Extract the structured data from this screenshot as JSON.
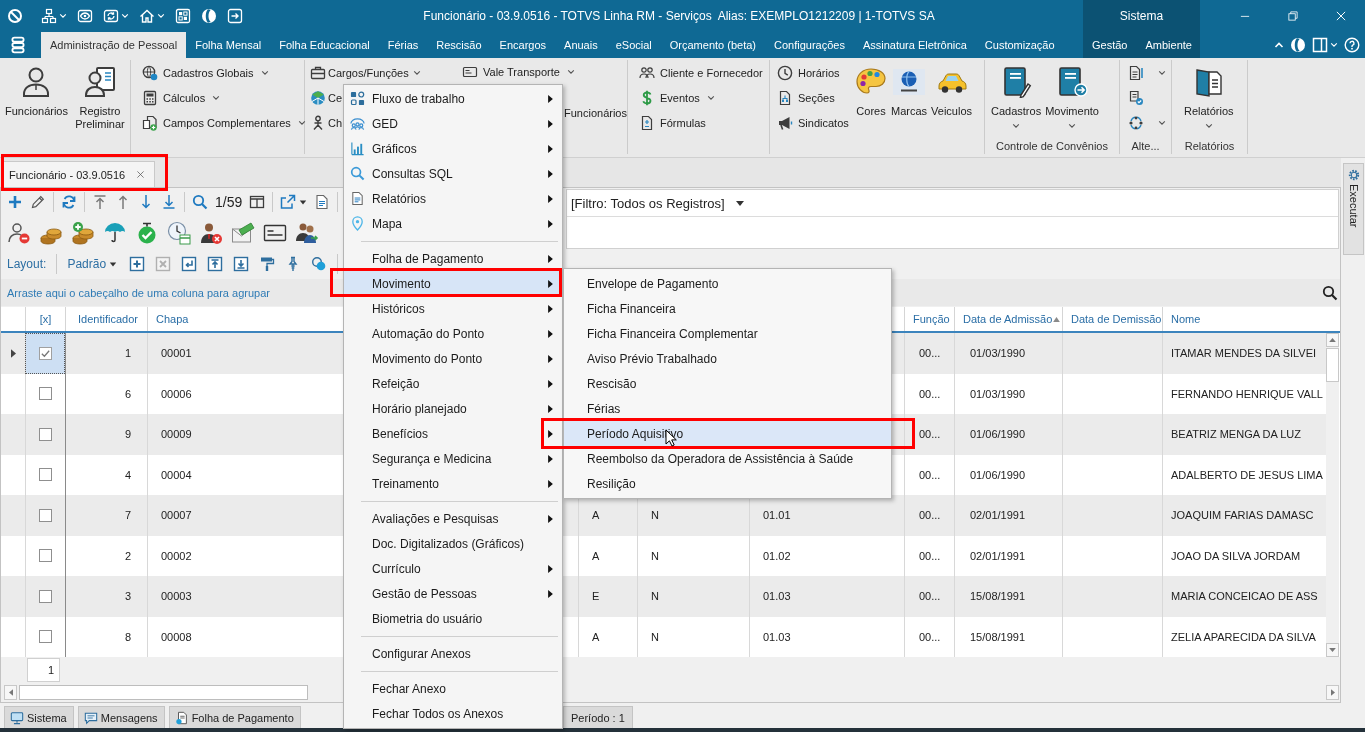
{
  "title_bar": {
    "title": "Funcionário - 03.9.0516 - TOTVS Linha RM - Serviços  Alias: EXEMPLO1212209 | 1-TOTVS SA",
    "context_title": "Sistema"
  },
  "ribbon": {
    "tabs": [
      {
        "label": "Administração de Pessoal",
        "selected": true,
        "kind": "main"
      },
      {
        "label": "Folha Mensal",
        "selected": false,
        "kind": "main"
      },
      {
        "label": "Folha Educacional",
        "selected": false,
        "kind": "main"
      },
      {
        "label": "Férias",
        "selected": false,
        "kind": "main"
      },
      {
        "label": "Rescisão",
        "selected": false,
        "kind": "main"
      },
      {
        "label": "Encargos",
        "selected": false,
        "kind": "main"
      },
      {
        "label": "Anuais",
        "selected": false,
        "kind": "main"
      },
      {
        "label": "eSocial",
        "selected": false,
        "kind": "main"
      },
      {
        "label": "Orçamento (beta)",
        "selected": false,
        "kind": "main"
      },
      {
        "label": "Configurações",
        "selected": false,
        "kind": "main"
      },
      {
        "label": "Assinatura Eletrônica",
        "selected": false,
        "kind": "main"
      },
      {
        "label": "Customização",
        "selected": false,
        "kind": "main"
      },
      {
        "label": "Gestão",
        "selected": false,
        "kind": "context"
      },
      {
        "label": "Ambiente",
        "selected": false,
        "kind": "context"
      }
    ],
    "groups": [
      {
        "items": [
          {
            "label": "Funcionários",
            "kind": "large",
            "dropdown": false
          },
          {
            "label": "Registro Preliminar",
            "kind": "large",
            "dropdown": false
          }
        ]
      },
      {
        "items": [
          {
            "label": "Cadastros Globais",
            "kind": "small",
            "dropdown": true
          },
          {
            "label": "Cálculos",
            "kind": "small",
            "dropdown": true
          },
          {
            "label": "Campos Complementares",
            "kind": "small",
            "dropdown": true
          }
        ]
      },
      {
        "items": [
          {
            "label": "Cargos/Funções",
            "kind": "small",
            "dropdown": true
          },
          {
            "label": "Ce",
            "kind": "small"
          },
          {
            "label": "Ch",
            "kind": "small"
          },
          {
            "label": "Vale Transporte",
            "kind": "medium",
            "dropdown": true
          },
          {
            "label": "Funcionários",
            "kind": "medium",
            "dropdown": false
          }
        ]
      },
      {
        "items": [
          {
            "label": "Cliente e Fornecedor",
            "kind": "small",
            "dropdown": false
          },
          {
            "label": "Eventos",
            "kind": "small",
            "dropdown": true
          },
          {
            "label": "Fórmulas",
            "kind": "small",
            "dropdown": false
          }
        ]
      },
      {
        "items": [
          {
            "label": "Horários",
            "kind": "small",
            "dropdown": false
          },
          {
            "label": "Seções",
            "kind": "small",
            "dropdown": false
          },
          {
            "label": "Sindicatos",
            "kind": "small",
            "dropdown": false
          },
          {
            "label": "Cores",
            "kind": "large",
            "dropdown": false
          },
          {
            "label": "Marcas",
            "kind": "large",
            "dropdown": false
          },
          {
            "label": "Veiculos",
            "kind": "large",
            "dropdown": false
          }
        ]
      },
      {
        "title": "Controle de Convênios",
        "items": [
          {
            "label": "Cadastros",
            "kind": "large",
            "dropdown": true
          },
          {
            "label": "Movimento",
            "kind": "large",
            "dropdown": true
          }
        ]
      },
      {
        "title": "Alte...",
        "items": [
          {
            "kind": "icon",
            "dropdown": true
          },
          {
            "kind": "icon",
            "dropdown": false
          },
          {
            "kind": "icon",
            "dropdown": true
          }
        ]
      },
      {
        "title": "Relatórios",
        "items": [
          {
            "label": "Relatórios",
            "kind": "large",
            "dropdown": true
          }
        ]
      }
    ]
  },
  "document_tabs": [
    {
      "label": "Funcionário - 03.9.0516",
      "selected": true,
      "highlighted": true
    }
  ],
  "side_panel": {
    "label": "Executar"
  },
  "toolbar": {
    "record_position": "1/59"
  },
  "filter": {
    "value": "[Filtro: Todos os Registros]"
  },
  "layout_bar": {
    "label": "Layout:",
    "layout": "Padrão"
  },
  "group_panel": {
    "hint": "Arraste aqui o cabeçalho de uma coluna para agrupar"
  },
  "table": {
    "columns": [
      {
        "label": "[x]"
      },
      {
        "label": "Identificador"
      },
      {
        "label": "Chapa"
      },
      {
        "label": "Função"
      },
      {
        "label": "Data de Admissão",
        "sorted": true
      },
      {
        "label": "Data de Demissão"
      },
      {
        "label": "Nome"
      }
    ],
    "rows": [
      {
        "selected": true,
        "checked": true,
        "identificador": "1",
        "chapa": "00001",
        "funcao": "00...",
        "data_de_admissao": "01/03/1990",
        "nome": "ITAMAR MENDES DA SILVEI"
      },
      {
        "selected": false,
        "checked": false,
        "identificador": "6",
        "chapa": "00006",
        "funcao": "00...",
        "data_de_admissao": "01/03/1990",
        "nome": "FERNANDO HENRIQUE VALL"
      },
      {
        "selected": false,
        "checked": false,
        "identificador": "9",
        "chapa": "00009",
        "funcao": "00...",
        "data_de_admissao": "01/06/1990",
        "nome": "BEATRIZ MENGA DA LUZ"
      },
      {
        "selected": false,
        "checked": false,
        "identificador": "4",
        "chapa": "00004",
        "funcao": "00...",
        "data_de_admissao": "01/06/1990",
        "nome": "ADALBERTO DE JESUS LIMA"
      },
      {
        "selected": false,
        "checked": false,
        "identificador": "7",
        "chapa": "00007",
        "column_4": "A",
        "column_5": "N",
        "column_6": "01.01",
        "funcao": "00...",
        "data_de_admissao": "02/01/1991",
        "nome": "JOAQUIM FARIAS DAMASC"
      },
      {
        "selected": false,
        "checked": false,
        "identificador": "2",
        "chapa": "00002",
        "column_4": "A",
        "column_5": "N",
        "column_6": "01.02",
        "funcao": "00...",
        "data_de_admissao": "02/01/1991",
        "nome": "JOAO DA SILVA JORDAM"
      },
      {
        "selected": false,
        "checked": false,
        "identificador": "3",
        "chapa": "00003",
        "column_4": "E",
        "column_5": "N",
        "column_6": "01.03",
        "funcao": "00...",
        "data_de_admissao": "15/08/1991",
        "nome": "MARIA CONCEICAO DE ASS"
      },
      {
        "selected": false,
        "checked": false,
        "identificador": "8",
        "chapa": "00008",
        "column_4": "A",
        "column_5": "N",
        "column_6": "01.03",
        "funcao": "00...",
        "data_de_admissao": "15/08/1991",
        "nome": "ZELIA APARECIDA DA SILVA"
      }
    ]
  },
  "pager": {
    "page": "1"
  },
  "context_menu": {
    "sections": [
      [
        {
          "label": "Fluxo de trabalho",
          "submenu": true,
          "selected": false,
          "highlighted": false
        },
        {
          "label": "GED",
          "submenu": true,
          "selected": false,
          "highlighted": false
        },
        {
          "label": "Gráficos",
          "submenu": true,
          "selected": false,
          "highlighted": false
        },
        {
          "label": "Consultas SQL",
          "submenu": true,
          "selected": false,
          "highlighted": false
        },
        {
          "label": "Relatórios",
          "submenu": true,
          "selected": false,
          "highlighted": false
        },
        {
          "label": "Mapa",
          "submenu": true,
          "selected": false,
          "highlighted": false
        }
      ],
      [
        {
          "label": "Folha de Pagamento",
          "submenu": true,
          "selected": false,
          "highlighted": false
        },
        {
          "label": "Movimento",
          "submenu": true,
          "selected": true,
          "highlighted": true
        },
        {
          "label": "Históricos",
          "submenu": true,
          "selected": false,
          "highlighted": false
        },
        {
          "label": "Automação do Ponto",
          "submenu": true,
          "selected": false,
          "highlighted": false
        },
        {
          "label": "Movimento do Ponto",
          "submenu": true,
          "selected": false,
          "highlighted": false
        },
        {
          "label": "Refeição",
          "submenu": true,
          "selected": false,
          "highlighted": false
        },
        {
          "label": "Horário planejado",
          "submenu": true,
          "selected": false,
          "highlighted": false
        },
        {
          "label": "Benefícios",
          "submenu": true,
          "selected": false,
          "highlighted": false
        },
        {
          "label": "Segurança e Medicina",
          "submenu": true,
          "selected": false,
          "highlighted": false
        },
        {
          "label": "Treinamento",
          "submenu": true,
          "selected": false,
          "highlighted": false
        }
      ],
      [
        {
          "label": "Avaliações e Pesquisas",
          "submenu": true,
          "selected": false,
          "highlighted": false
        },
        {
          "label": "Doc. Digitalizados (Gráficos)",
          "submenu": false,
          "selected": false,
          "highlighted": false
        },
        {
          "label": "Currículo",
          "submenu": true,
          "selected": false,
          "highlighted": false
        },
        {
          "label": "Gestão de Pessoas",
          "submenu": true,
          "selected": false,
          "highlighted": false
        },
        {
          "label": "Biometria do usuário",
          "submenu": false,
          "selected": false,
          "highlighted": false
        }
      ],
      [
        {
          "label": "Configurar Anexos",
          "submenu": false,
          "selected": false,
          "highlighted": false
        }
      ],
      [
        {
          "label": "Fechar Anexo",
          "submenu": false,
          "selected": false,
          "highlighted": false
        },
        {
          "label": "Fechar Todos os Anexos",
          "submenu": false,
          "selected": false,
          "highlighted": false
        }
      ]
    ]
  },
  "submenu": {
    "items": [
      {
        "label": "Envelope de Pagamento",
        "selected": false,
        "highlighted": false
      },
      {
        "label": "Ficha Financeira",
        "selected": false,
        "highlighted": false
      },
      {
        "label": "Ficha Financeira Complementar",
        "selected": false,
        "highlighted": false
      },
      {
        "label": "Aviso Prévio Trabalhado",
        "selected": false,
        "highlighted": false
      },
      {
        "label": "Rescisão",
        "selected": false,
        "highlighted": false
      },
      {
        "label": "Férias",
        "selected": false,
        "highlighted": false
      },
      {
        "label": "Período Aquisitivo",
        "selected": true,
        "highlighted": true
      },
      {
        "label": "Reembolso da Operadora de Assistência à Saúde",
        "selected": false,
        "highlighted": false
      },
      {
        "label": "Resilição",
        "selected": false,
        "highlighted": false
      }
    ]
  },
  "status_bar": {
    "tabs": [
      {
        "label": "Sistema"
      },
      {
        "label": "Mensagens"
      },
      {
        "label": "Folha de Pagamento"
      }
    ],
    "period": "Período : 1"
  }
}
